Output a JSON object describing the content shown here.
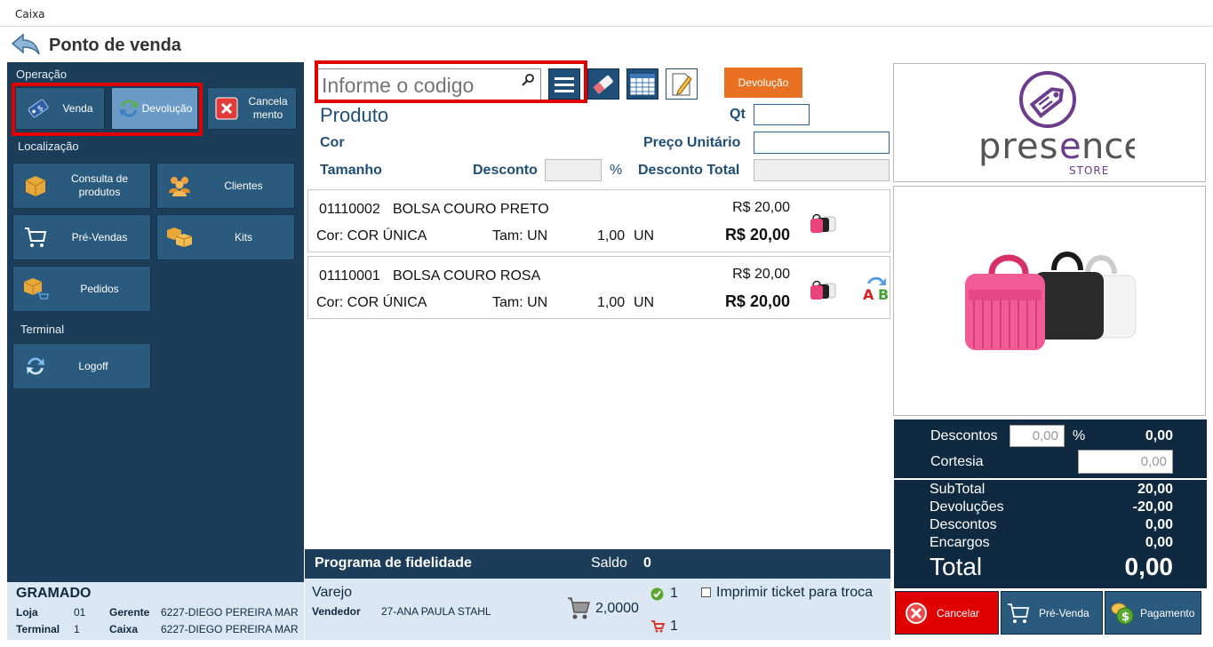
{
  "window": {
    "title": "Caixa"
  },
  "header": {
    "title": "Ponto de venda"
  },
  "sidebar": {
    "operacao_title": "Operação",
    "operacao": [
      {
        "label": "Venda",
        "icon": "price-tag-icon"
      },
      {
        "label": "Devolução",
        "icon": "refresh-icon"
      },
      {
        "label": "Cancela mento",
        "icon": "close-icon"
      }
    ],
    "localizacao_title": "Localização",
    "localizacao": [
      {
        "label": "Consulta de produtos",
        "icon": "box-icon"
      },
      {
        "label": "Clientes",
        "icon": "people-icon"
      },
      {
        "label": "Pré-Vendas",
        "icon": "cart-icon"
      },
      {
        "label": "Kits",
        "icon": "boxes-icon"
      },
      {
        "label": "Pedidos",
        "icon": "box-cart-icon"
      }
    ],
    "terminal_title": "Terminal",
    "terminal": [
      {
        "label": "Logoff",
        "icon": "refresh-icon"
      }
    ]
  },
  "store_info": {
    "city": "GRAMADO",
    "loja_label": "Loja",
    "loja_value": "01",
    "gerente_label": "Gerente",
    "gerente_value": "6227-DIEGO PEREIRA MAR",
    "terminal_label": "Terminal",
    "terminal_value": "1",
    "caixa_label": "Caixa",
    "caixa_value": "6227-DIEGO PEREIRA MAR"
  },
  "search": {
    "placeholder": "Informe o codigo"
  },
  "mode_tag": "Devolução",
  "fields": {
    "produto": "Produto",
    "qt": "Qt",
    "cor": "Cor",
    "preco_unitario": "Preço Unitário",
    "tamanho": "Tamanho",
    "desconto": "Desconto",
    "percent": "%",
    "desconto_total": "Desconto Total"
  },
  "items": [
    {
      "code": "01110002",
      "name": "BOLSA COURO PRETO",
      "cor": "Cor: COR ÚNICA",
      "tam": "Tam: UN",
      "qty": "1,00",
      "unit": "UN",
      "price": "R$ 20,00",
      "total": "R$ 20,00"
    },
    {
      "code": "01110001",
      "name": "BOLSA COURO ROSA",
      "cor": "Cor: COR ÚNICA",
      "tam": "Tam: UN",
      "qty": "1,00",
      "unit": "UN",
      "price": "R$ 20,00",
      "total": "R$ 20,00"
    }
  ],
  "fidelidade": {
    "title": "Programa de fidelidade",
    "saldo_label": "Saldo",
    "saldo_value": "0"
  },
  "sale": {
    "type": "Varejo",
    "vendedor_label": "Vendedor",
    "vendedor_value": "27-ANA PAULA STAHL",
    "cart_qty": "2,0000",
    "check_count": "1",
    "cart_count": "1",
    "print_ticket": "Imprimir ticket para troca"
  },
  "brand": {
    "name": "presence",
    "sub": "STORE",
    "color": "#6b3d8c"
  },
  "totals": {
    "descontos_label": "Descontos",
    "descontos_input": "0,00",
    "descontos_pct": "%",
    "descontos_value": "0,00",
    "cortesia_label": "Cortesia",
    "cortesia_input": "0,00",
    "subtotal_label": "SubTotal",
    "subtotal_value": "20,00",
    "devolucoes_label": "Devoluções",
    "devolucoes_value": "-20,00",
    "descontos2_label": "Descontos",
    "descontos2_value": "0,00",
    "encargos_label": "Encargos",
    "encargos_value": "0,00",
    "total_label": "Total",
    "total_value": "0,00"
  },
  "actions": {
    "cancelar": "Cancelar",
    "pre_venda": "Pré-Venda",
    "pagamento": "Pagamento"
  },
  "colors": {
    "sidebar": "#1b3d5a",
    "button": "#2a5a7e",
    "highlight": "#e00000",
    "orange": "#e97222"
  }
}
